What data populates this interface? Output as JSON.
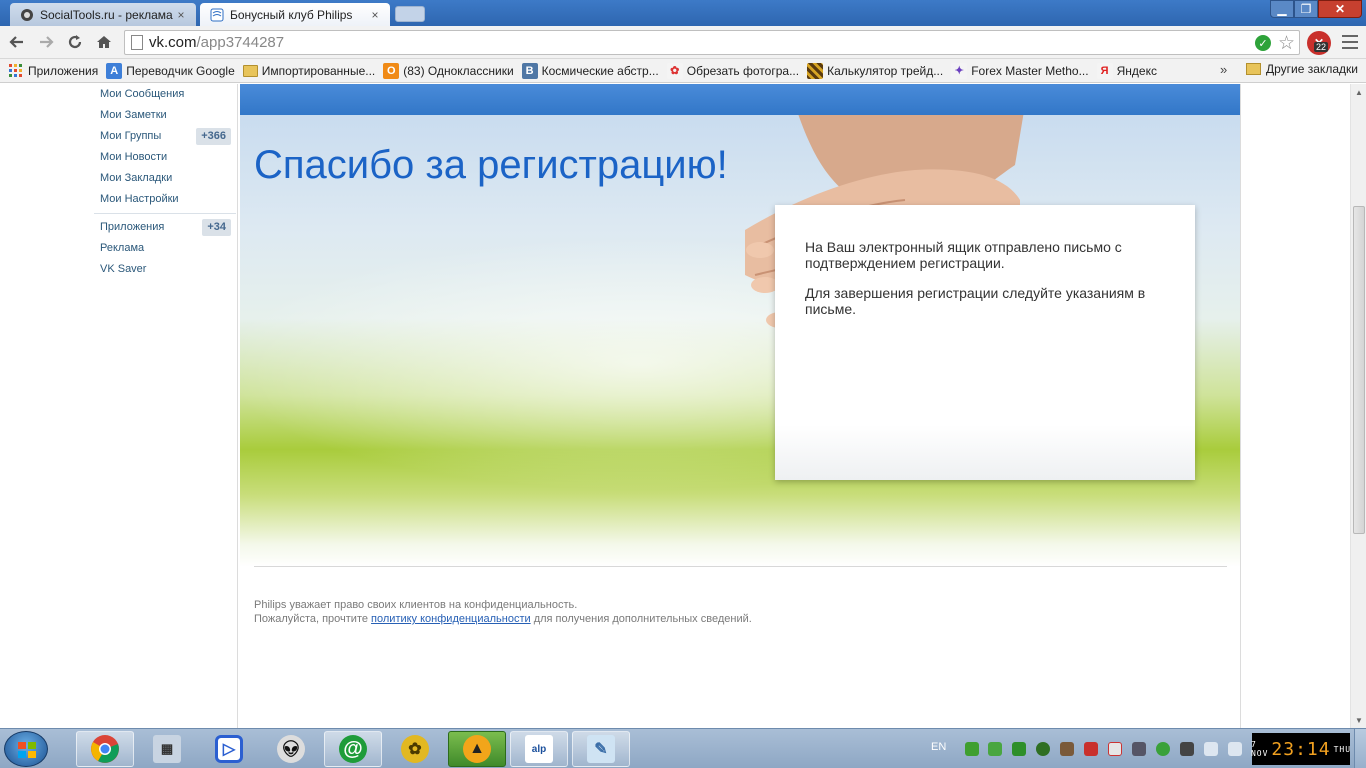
{
  "browser": {
    "tabs": [
      {
        "title": "SocialTools.ru - реклама",
        "close": "×"
      },
      {
        "title": "Бонусный клуб Philips",
        "close": "×"
      }
    ],
    "url_host": "vk.com",
    "url_path": "/app3744287",
    "extension_badge": "22",
    "window_controls": {
      "minimize": "▁",
      "maximize": "❐",
      "close": "✕"
    }
  },
  "bookmarks": {
    "items": [
      {
        "label": "Приложения",
        "icon": "apps-grid-icon"
      },
      {
        "label": "Переводчик Google",
        "icon": "google-translate-icon"
      },
      {
        "label": "Импортированные...",
        "icon": "folder-icon"
      },
      {
        "label": "(83) Одноклассники",
        "icon": "odnoklassniki-icon"
      },
      {
        "label": "Космические абстр...",
        "icon": "vk-icon"
      },
      {
        "label": "Обрезать фотогра...",
        "icon": "crop-icon"
      },
      {
        "label": "Калькулятор трейд...",
        "icon": "calculator-icon"
      },
      {
        "label": "Forex Master Metho...",
        "icon": "forex-icon"
      },
      {
        "label": "Яндекс",
        "icon": "yandex-icon"
      }
    ],
    "more": "»",
    "other": "Другие закладки"
  },
  "vk_menu": {
    "items": [
      {
        "label": "Мои Сообщения",
        "badge": ""
      },
      {
        "label": "Мои Заметки",
        "badge": ""
      },
      {
        "label": "Мои Группы",
        "badge": "+366"
      },
      {
        "label": "Мои Новости",
        "badge": ""
      },
      {
        "label": "Мои Закладки",
        "badge": ""
      },
      {
        "label": "Мои Настройки",
        "badge": ""
      }
    ],
    "items2": [
      {
        "label": "Приложения",
        "badge": "+34"
      },
      {
        "label": "Реклама",
        "badge": ""
      },
      {
        "label": "VK Saver",
        "badge": ""
      }
    ]
  },
  "app": {
    "title": "Спасибо за регистрацию!",
    "notice_p1": "На Ваш электронный ящик отправлено письмо с подтверждением регистрации.",
    "notice_p2": "Для завершения регистрации следуйте указаниям в письме.",
    "footer_line1": "Philips уважает право своих клиентов на конфиденциальность.",
    "footer_line2_pre": "Пожалуйста, прочтите ",
    "footer_link": "политику конфиденциальности",
    "footer_line2_post": " для получения дополнительных сведений."
  },
  "taskbar": {
    "lang": "EN",
    "clock_time": "23:14",
    "clock_month": "NOV",
    "clock_day": "7",
    "clock_weekday": "THU",
    "apps": [
      "chrome-icon",
      "calculator-icon",
      "daum-player-icon",
      "alien-icon",
      "mail-agent-icon",
      "icq-icon",
      "aimp-icon",
      "alpari-icon",
      "notepad-icon"
    ]
  },
  "colors": {
    "accent_blue": "#1b63c6",
    "vk_link": "#2b587a",
    "app_bar": "#3277c8"
  }
}
